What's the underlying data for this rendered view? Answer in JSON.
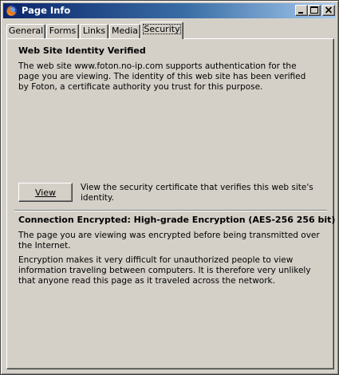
{
  "window": {
    "title": "Page Info",
    "icon": "firefox-icon",
    "controls": {
      "minimize": "minimize-icon",
      "maximize": "maximize-icon",
      "close": "close-icon"
    }
  },
  "tabs": [
    {
      "label": "General",
      "active": false
    },
    {
      "label": "Forms",
      "active": false
    },
    {
      "label": "Links",
      "active": false
    },
    {
      "label": "Media",
      "active": false
    },
    {
      "label": "Security",
      "active": true
    }
  ],
  "identity": {
    "heading": "Web Site Identity Verified",
    "description": "The web site www.foton.no-ip.com supports authentication for the page you are viewing. The identity of this web site has been verified by Foton, a certificate authority you trust for this purpose.",
    "view_button_label": "View",
    "view_description": "View the security certificate that verifies this web site's identity."
  },
  "encryption": {
    "heading": "Connection Encrypted: High-grade Encryption (AES-256 256 bit)",
    "paragraph1": "The page you are viewing was encrypted before being transmitted over the Internet.",
    "paragraph2": "Encryption makes it very difficult for unauthorized people to view information traveling between computers. It is therefore very unlikely that anyone read this page as it traveled across the network."
  },
  "colors": {
    "titlebar_start": "#0a246a",
    "titlebar_end": "#a6caf0",
    "dialog_face": "#d4d0c8"
  }
}
